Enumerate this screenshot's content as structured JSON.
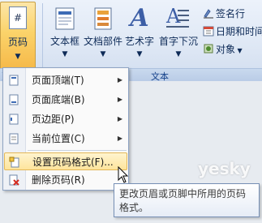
{
  "ribbon": {
    "page_number_btn": {
      "label": "页码",
      "icon": "page-number-icon",
      "hash": "#"
    },
    "textbox_btn": {
      "label": "文本框",
      "icon": "textbox-icon"
    },
    "quickparts_btn": {
      "label": "文档部件",
      "icon": "quick-parts-icon"
    },
    "wordart_btn": {
      "label": "艺术字",
      "icon": "wordart-icon",
      "glyph": "A"
    },
    "dropcap_btn": {
      "label": "首字下沉",
      "icon": "drop-cap-icon",
      "glyph": "A"
    },
    "signature_btn": {
      "label": "签名行",
      "icon": "signature-icon"
    },
    "datetime_btn": {
      "label": "日期和时间",
      "icon": "calendar-icon"
    },
    "object_btn": {
      "label": "对象",
      "icon": "object-icon"
    },
    "left_group_stub": "页",
    "text_group_label": "文本"
  },
  "menu": {
    "items": [
      {
        "label": "页面顶端(T)",
        "icon": "page-top-icon",
        "submenu": true
      },
      {
        "label": "页面底端(B)",
        "icon": "page-bottom-icon",
        "submenu": true
      },
      {
        "label": "页边距(P)",
        "icon": "page-margin-icon",
        "submenu": true
      },
      {
        "label": "当前位置(C)",
        "icon": "current-position-icon",
        "submenu": true
      },
      {
        "label": "设置页码格式(F)...",
        "icon": "format-page-number-icon",
        "submenu": false,
        "highlighted": true
      },
      {
        "label": "删除页码(R)",
        "icon": "remove-page-number-icon",
        "submenu": false
      }
    ]
  },
  "tooltip": {
    "text": "更改页眉或页脚中所用的页码格式。"
  },
  "watermark": "yesky",
  "colors": {
    "highlight": "#fde49c",
    "ribbon": "#dfe8f5",
    "accent": "#15428b"
  }
}
